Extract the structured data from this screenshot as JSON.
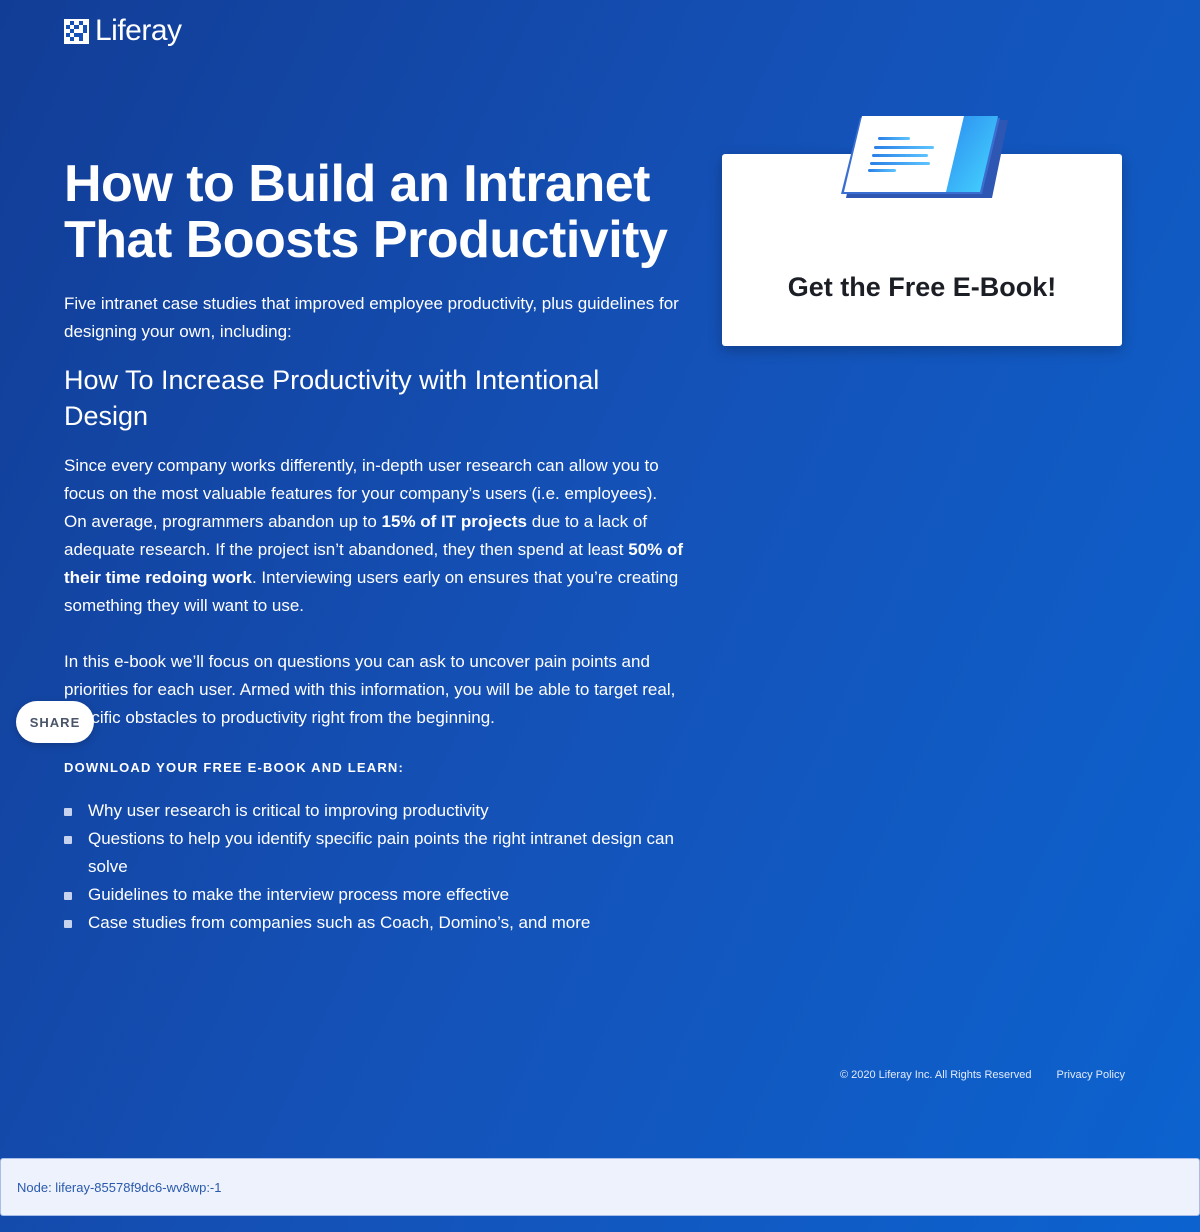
{
  "brand": {
    "name": "Liferay"
  },
  "hero": {
    "title": "How to Build an Intranet That Boosts Productivity",
    "intro": "Five intranet case studies that improved employee productivity, plus guidelines for designing your own, including:",
    "subhead": "How To Increase Productivity with Intentional Design",
    "para1": {
      "part1": "Since every company works differently, in-depth user research can allow you to focus on the most valuable features for your company’s users (i.e. employees). On average, programmers abandon up to ",
      "bold1": "15% of IT projects",
      "part2": " due to a lack of adequate research. If the project isn’t abandoned, they then spend at least ",
      "bold2": "50% of their time redoing work",
      "part3": ". Interviewing users early on ensures that you’re creating something they will want to use."
    },
    "para2": "In this e-book we’ll focus on questions you can ask to uncover pain points and priorities for each user. Armed with this information, you will be able to target real, specific obstacles to productivity right from the beginning.",
    "list_label": "DOWNLOAD YOUR FREE E-BOOK AND LEARN:",
    "bullets": [
      "Why user research is critical to improving productivity",
      "Questions to help you identify specific pain points the right intranet design can solve",
      "Guidelines to make the interview process more effective",
      "Case studies from companies such as Coach, Domino’s, and more"
    ]
  },
  "share": {
    "label": "SHARE"
  },
  "card": {
    "title": "Get the Free E-Book!"
  },
  "footer": {
    "copyright": "© 2020 Liferay Inc. All Rights Reserved",
    "privacy": "Privacy Policy"
  },
  "node_bar": {
    "text": "Node: liferay-85578f9dc6-wv8wp:-1"
  },
  "colors": {
    "background": "#1450b5",
    "card": "#ffffff",
    "accent": "#3fb2ff"
  },
  "icons": {
    "logo": "liferay-logo-icon",
    "book": "ebook-icon"
  }
}
